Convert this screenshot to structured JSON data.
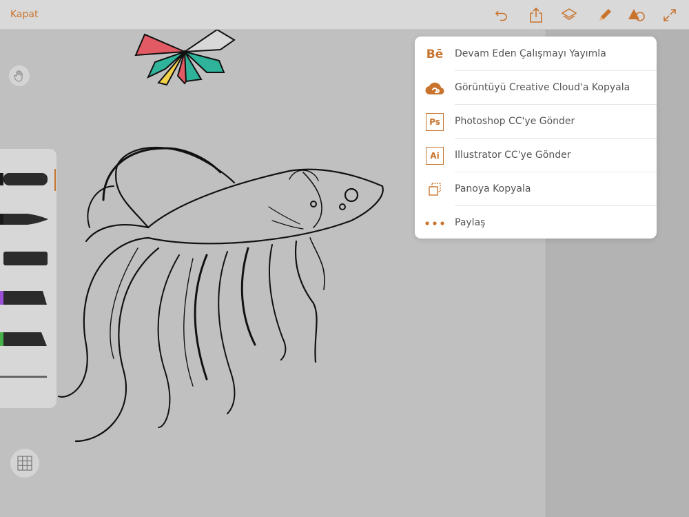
{
  "toolbar": {
    "close_label": "Kapat",
    "icons": [
      "undo-icon",
      "share-icon",
      "layers-icon",
      "pencil-icon",
      "shapes-icon",
      "expand-icon"
    ]
  },
  "share_menu": {
    "items": [
      {
        "label": "Devam Eden Çalışmayı Yayımla",
        "icon": "behance-icon",
        "icon_text": "Bē"
      },
      {
        "label": "Görüntüyü Creative Cloud'a Kopyala",
        "icon": "creative-cloud-icon"
      },
      {
        "label": "Photoshop CC'ye Gönder",
        "icon": "photoshop-icon",
        "icon_text": "Ps"
      },
      {
        "label": "Illustrator CC'ye Gönder",
        "icon": "illustrator-icon",
        "icon_text": "Ai"
      },
      {
        "label": "Panoya Kopyala",
        "icon": "clipboard-copy-icon"
      },
      {
        "label": "Paylaş",
        "icon": "more-dots-icon"
      }
    ]
  },
  "brushes": [
    {
      "name": "round-brush",
      "color": "#2b2b2b",
      "accent": "#2b2b2b"
    },
    {
      "name": "taper-brush",
      "color": "#2b2b2b",
      "accent": "#2b2b2b"
    },
    {
      "name": "flat-brush",
      "color": "#2b2b2b",
      "accent": "#2b2b2b"
    },
    {
      "name": "marker-brush",
      "color": "#2b2b2b",
      "accent": "#9b4fd6"
    },
    {
      "name": "ink-brush",
      "color": "#2b2b2b",
      "accent": "#46b04a"
    },
    {
      "name": "pencil-brush",
      "color": "#555555",
      "accent": "#555555"
    }
  ],
  "colors": {
    "accent": "#c8742d",
    "toolbar_bg": "#d9d9d9",
    "canvas_bg": "#c0c0c0"
  }
}
